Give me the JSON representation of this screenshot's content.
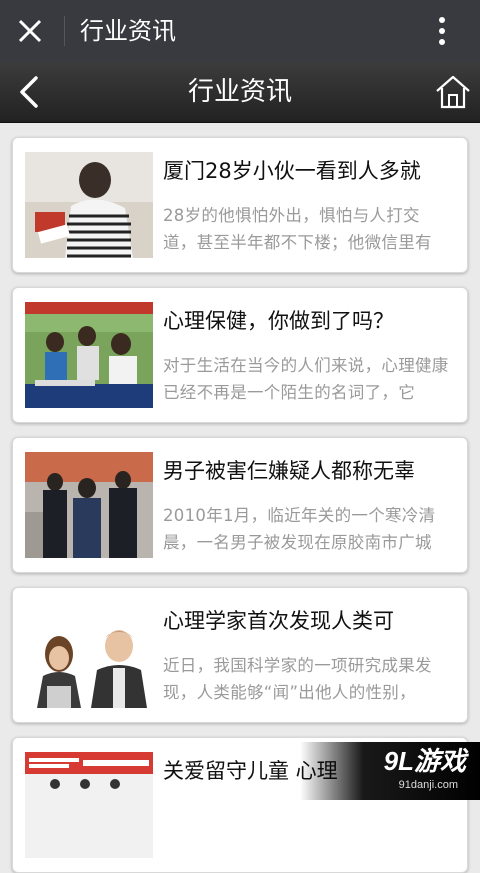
{
  "wechat_bar": {
    "title": "行业资讯"
  },
  "app_bar": {
    "title": "行业资讯"
  },
  "articles": [
    {
      "title": "厦门28岁小伙一看到人多就",
      "summary": "28岁的他惧怕外出，惧怕与人打交道，甚至半年都不下楼；他微信里有"
    },
    {
      "title": "心理保健，你做到了吗？",
      "summary": "对于生活在当今的人们来说，心理健康已经不再是一个陌生的名词了，它"
    },
    {
      "title": "男子被害仨嫌疑人都称无辜",
      "summary": "2010年1月，临近年关的一个寒冷清晨，一名男子被发现在原胶南市广城"
    },
    {
      "title": "心理学家首次发现人类可",
      "summary": "近日，我国科学家的一项研究成果发现，人类能够“闻”出他人的性别，"
    },
    {
      "title": "关爱留守儿童 心理",
      "summary": ""
    }
  ],
  "watermark": {
    "logo": "9L游戏",
    "url": "91danji.com"
  },
  "colors": {
    "wechat_bar": "#393a3f",
    "app_bar": "#2a2a2a",
    "background": "#eaeaea"
  }
}
